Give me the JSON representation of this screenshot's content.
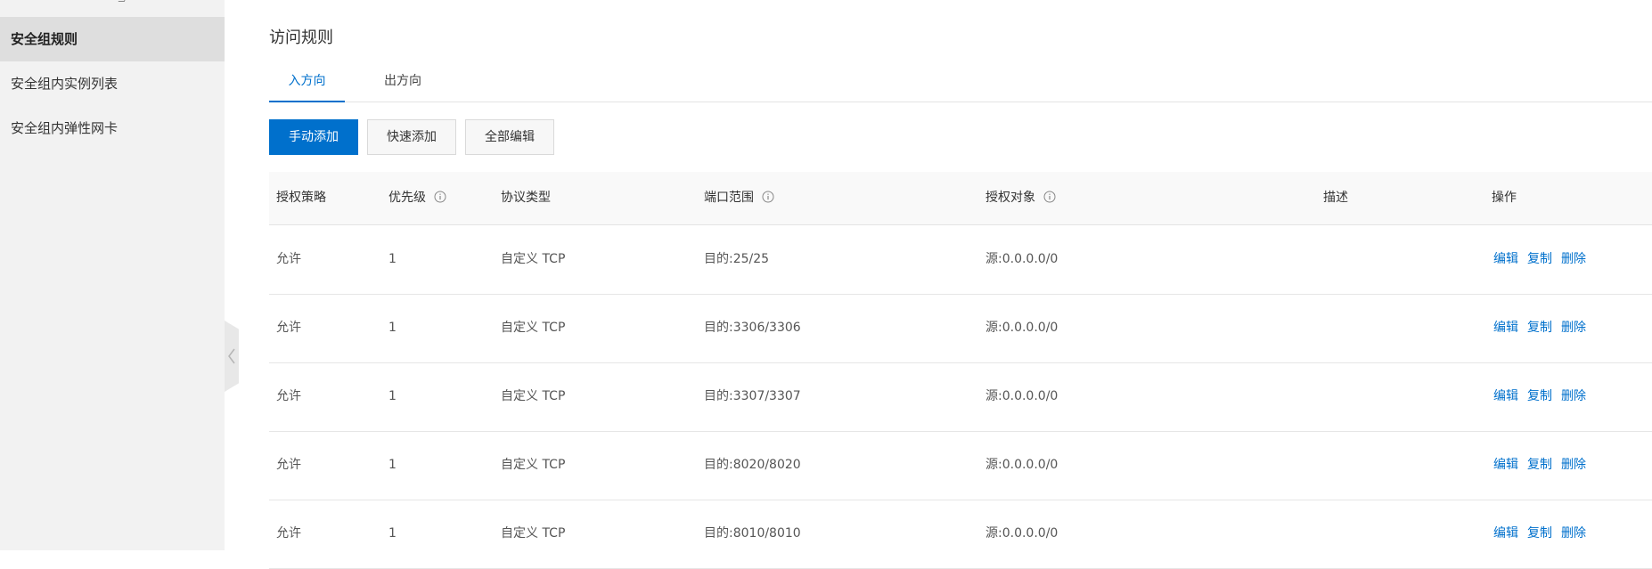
{
  "sidebar": {
    "items": [
      {
        "label": "安全组规则",
        "active": true
      },
      {
        "label": "安全组内实例列表",
        "active": false
      },
      {
        "label": "安全组内弹性网卡",
        "active": false
      }
    ]
  },
  "page": {
    "title": "访问规则"
  },
  "tabs": [
    {
      "label": "入方向",
      "active": true
    },
    {
      "label": "出方向",
      "active": false
    }
  ],
  "toolbar": {
    "manual_add": "手动添加",
    "quick_add": "快速添加",
    "edit_all": "全部编辑"
  },
  "table": {
    "headers": [
      "授权策略",
      "优先级",
      "协议类型",
      "端口范围",
      "授权对象",
      "描述",
      "操作"
    ],
    "actions": [
      "编辑",
      "复制",
      "删除"
    ],
    "rows": [
      {
        "policy": "允许",
        "priority": "1",
        "protocol": "自定义 TCP",
        "port": "目的:25/25",
        "source": "源:0.0.0.0/0",
        "desc": ""
      },
      {
        "policy": "允许",
        "priority": "1",
        "protocol": "自定义 TCP",
        "port": "目的:3306/3306",
        "source": "源:0.0.0.0/0",
        "desc": ""
      },
      {
        "policy": "允许",
        "priority": "1",
        "protocol": "自定义 TCP",
        "port": "目的:3307/3307",
        "source": "源:0.0.0.0/0",
        "desc": ""
      },
      {
        "policy": "允许",
        "priority": "1",
        "protocol": "自定义 TCP",
        "port": "目的:8020/8020",
        "source": "源:0.0.0.0/0",
        "desc": ""
      },
      {
        "policy": "允许",
        "priority": "1",
        "protocol": "自定义 TCP",
        "port": "目的:8010/8010",
        "source": "源:0.0.0.0/0",
        "desc": ""
      }
    ]
  },
  "colors": {
    "accent": "#0070cc",
    "sidebar_bg": "#f2f2f2",
    "sidebar_active_bg": "#dedede"
  }
}
